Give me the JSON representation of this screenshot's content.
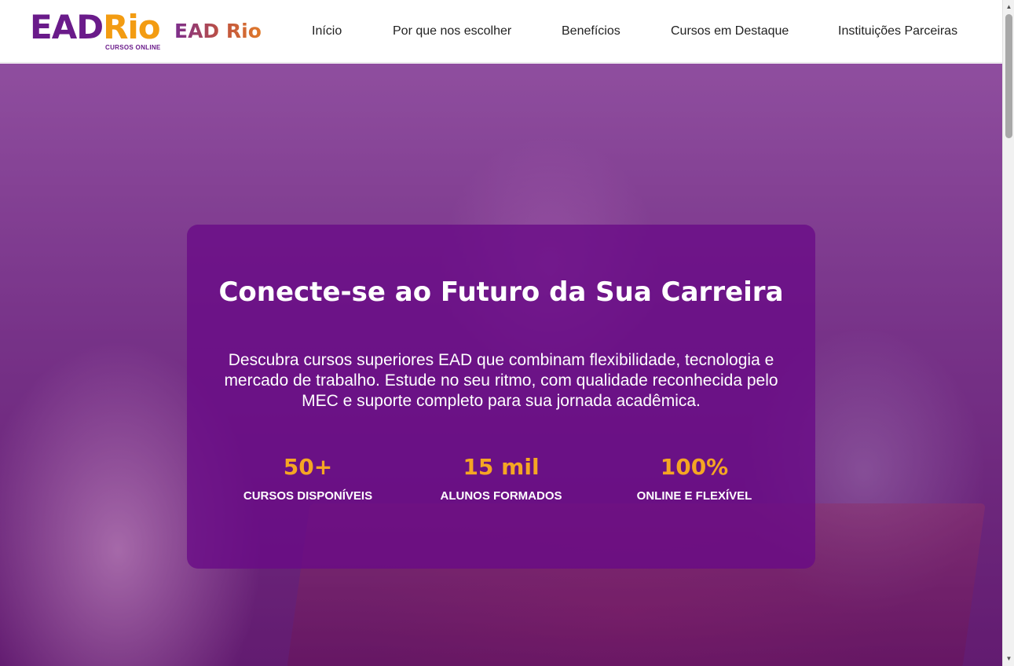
{
  "header": {
    "logo": {
      "ead": "EAD",
      "rio": "Rio",
      "sub": "CURSOS ONLINE"
    },
    "brand_name": "EAD Rio",
    "nav": [
      {
        "label": "Início"
      },
      {
        "label": "Por que nos escolher"
      },
      {
        "label": "Benefícios"
      },
      {
        "label": "Cursos em Destaque"
      },
      {
        "label": "Instituições Parceiras"
      }
    ]
  },
  "hero": {
    "title": "Conecte-se ao Futuro da Sua Carreira",
    "description": "Descubra cursos superiores EAD que combinam flexibilidade, tecnologia e mercado de trabalho. Estude no seu ritmo, com qualidade reconhecida pelo MEC e suporte completo para sua jornada acadêmica.",
    "stats": [
      {
        "value": "50+",
        "label": "CURSOS DISPONÍVEIS"
      },
      {
        "value": "15 mil",
        "label": "ALUNOS FORMADOS"
      },
      {
        "value": "100%",
        "label": "ONLINE E FLEXÍVEL"
      }
    ]
  },
  "colors": {
    "brand_purple": "#6a1b8a",
    "brand_orange": "#f39c12",
    "stat_accent": "#f5a623",
    "card_overlay": "#690a87"
  },
  "scrollbar": {
    "up_icon": "triangle-up-icon",
    "down_icon": "triangle-down-icon"
  }
}
